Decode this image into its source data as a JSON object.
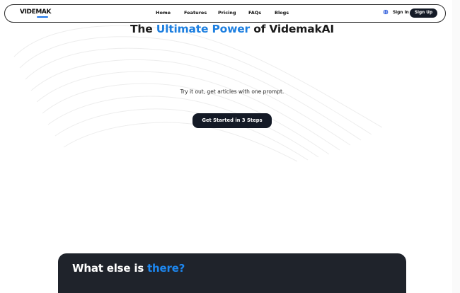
{
  "brand": {
    "logo_text": "VIDEMAK"
  },
  "nav": {
    "links": [
      "Home",
      "Features",
      "Pricing",
      "FAQs",
      "Blogs"
    ],
    "signin": "Sign In",
    "signup": "Sign Up"
  },
  "hero": {
    "title_pre": "The ",
    "title_accent": "Ultimate Power",
    "title_post": " of VidemakAI",
    "subtitle": "Try it out, get articles with one prompt.",
    "cta": "Get Started in 3 Steps"
  },
  "section": {
    "title_pre": "What else is ",
    "title_accent": "there?"
  },
  "colors": {
    "accent": "#1d7fe0",
    "dark_button": "#141a26",
    "dark_section": "#1f232b"
  },
  "icons": {
    "language": "globe-icon"
  }
}
